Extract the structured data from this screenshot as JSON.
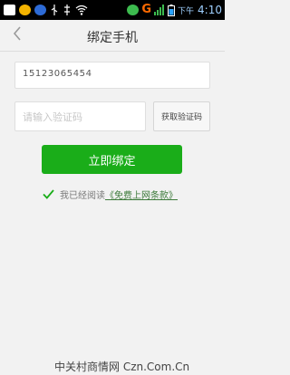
{
  "statusbar": {
    "network_label": "G",
    "time_prefix": "下午",
    "time": "4:10",
    "icons": [
      "notification-icon",
      "bear-icon",
      "badge-icon",
      "usb-icon",
      "usb-debug-icon",
      "wifi-icon",
      "signal-icon",
      "battery-icon"
    ]
  },
  "navbar": {
    "title": "绑定手机",
    "back_icon": "chevron-left-icon"
  },
  "form": {
    "phone_value": "15123065454",
    "code_placeholder": "请输入验证码",
    "get_code_label": "获取验证码",
    "bind_label": "立即绑定",
    "agree_text": "我已经阅读",
    "terms_label": "《免费上网条款》"
  },
  "watermark": "中关村商情网 Czn.Com.Cn",
  "colors": {
    "primary": "#1aad19",
    "background": "#f2f2f2"
  }
}
